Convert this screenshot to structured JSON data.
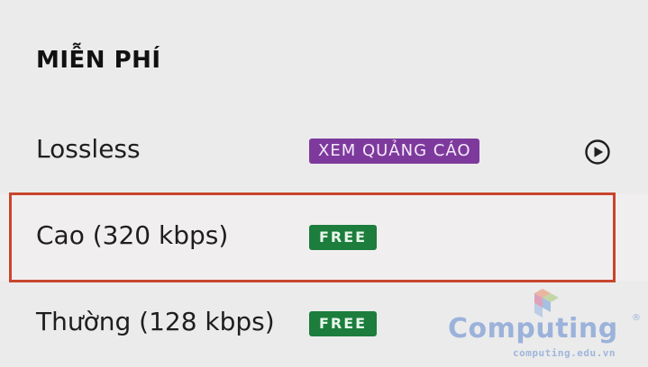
{
  "section": {
    "title": "MIỄN PHÍ"
  },
  "options": [
    {
      "label": "Lossless",
      "badge": "XEM QUẢNG CÁO",
      "badge_color": "#7d3a9c",
      "trailing_icon": "play-circle-icon",
      "selected": false
    },
    {
      "label": "Cao (320 kbps)",
      "badge": "FREE",
      "badge_color": "#1c7d3c",
      "selected": true
    },
    {
      "label": "Thường (128 kbps)",
      "badge": "FREE",
      "badge_color": "#1c7d3c",
      "selected": false
    }
  ],
  "highlight_color": "#c8452c",
  "watermark": {
    "name": "Computing",
    "registered_mark": "®",
    "url": "computing.edu.vn",
    "color": "#8ea9d8"
  }
}
